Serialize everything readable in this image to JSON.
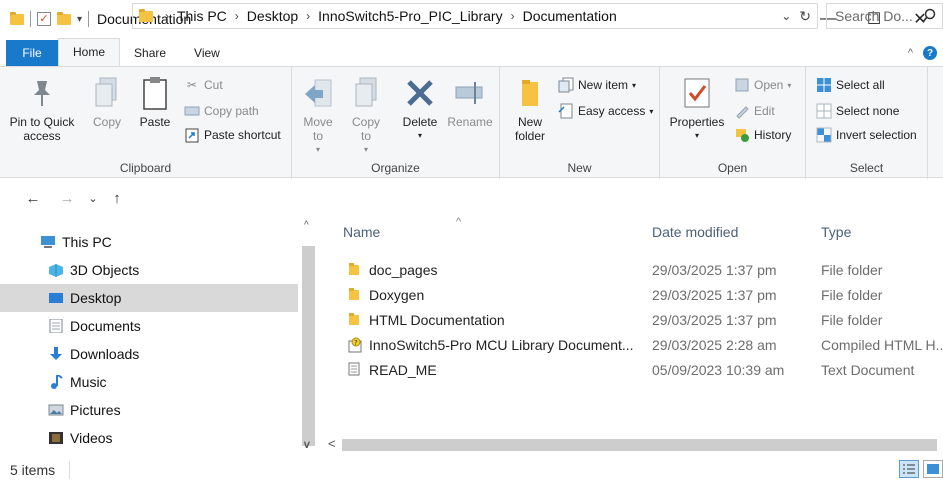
{
  "window": {
    "title": "Documentation",
    "minimize": "—",
    "maximize": "☐",
    "close": "✕"
  },
  "tabs": [
    {
      "label": "File"
    },
    {
      "label": "Home"
    },
    {
      "label": "Share"
    },
    {
      "label": "View"
    }
  ],
  "ribbon": {
    "clipboard": {
      "label": "Clipboard",
      "pin": "Pin to Quick access",
      "copy": "Copy",
      "paste": "Paste",
      "cut": "Cut",
      "copy_path": "Copy path",
      "paste_shortcut": "Paste shortcut"
    },
    "organize": {
      "label": "Organize",
      "move_to": "Move to",
      "copy_to": "Copy to",
      "delete": "Delete",
      "rename": "Rename"
    },
    "new": {
      "label": "New",
      "new_folder": "New folder",
      "new_item": "New item",
      "easy_access": "Easy access"
    },
    "open": {
      "label": "Open",
      "properties": "Properties",
      "open": "Open",
      "edit": "Edit",
      "history": "History"
    },
    "select": {
      "label": "Select",
      "select_all": "Select all",
      "select_none": "Select none",
      "invert": "Invert selection"
    }
  },
  "address": {
    "crumbs": [
      "This PC",
      "Desktop",
      "InnoSwitch5-Pro_PIC_Library",
      "Documentation"
    ],
    "search_placeholder": "Search Do..."
  },
  "nav_pane": [
    {
      "label": "This PC",
      "icon": "pc-icon"
    },
    {
      "label": "3D Objects",
      "icon": "3d-objects-icon"
    },
    {
      "label": "Desktop",
      "icon": "desktop-icon",
      "selected": true
    },
    {
      "label": "Documents",
      "icon": "documents-icon"
    },
    {
      "label": "Downloads",
      "icon": "downloads-icon"
    },
    {
      "label": "Music",
      "icon": "music-icon"
    },
    {
      "label": "Pictures",
      "icon": "pictures-icon"
    },
    {
      "label": "Videos",
      "icon": "videos-icon"
    }
  ],
  "columns": {
    "name": "Name",
    "date": "Date modified",
    "type": "Type"
  },
  "files": [
    {
      "name": "doc_pages",
      "date": "29/03/2025 1:37 pm",
      "type": "File folder",
      "icon": "folder-icon"
    },
    {
      "name": "Doxygen",
      "date": "29/03/2025 1:37 pm",
      "type": "File folder",
      "icon": "folder-icon"
    },
    {
      "name": "HTML Documentation",
      "date": "29/03/2025 1:37 pm",
      "type": "File folder",
      "icon": "folder-icon"
    },
    {
      "name": "InnoSwitch5-Pro MCU Library Document...",
      "date": "29/03/2025 2:28 am",
      "type": "Compiled HTML H...",
      "icon": "chm-help-icon"
    },
    {
      "name": "READ_ME",
      "date": "05/09/2023 10:39 am",
      "type": "Text Document",
      "icon": "text-document-icon"
    }
  ],
  "status": {
    "items": "5 items"
  },
  "colors": {
    "accent": "#1979ca",
    "folder": "#f5c242",
    "selected": "#d9d9d9"
  }
}
